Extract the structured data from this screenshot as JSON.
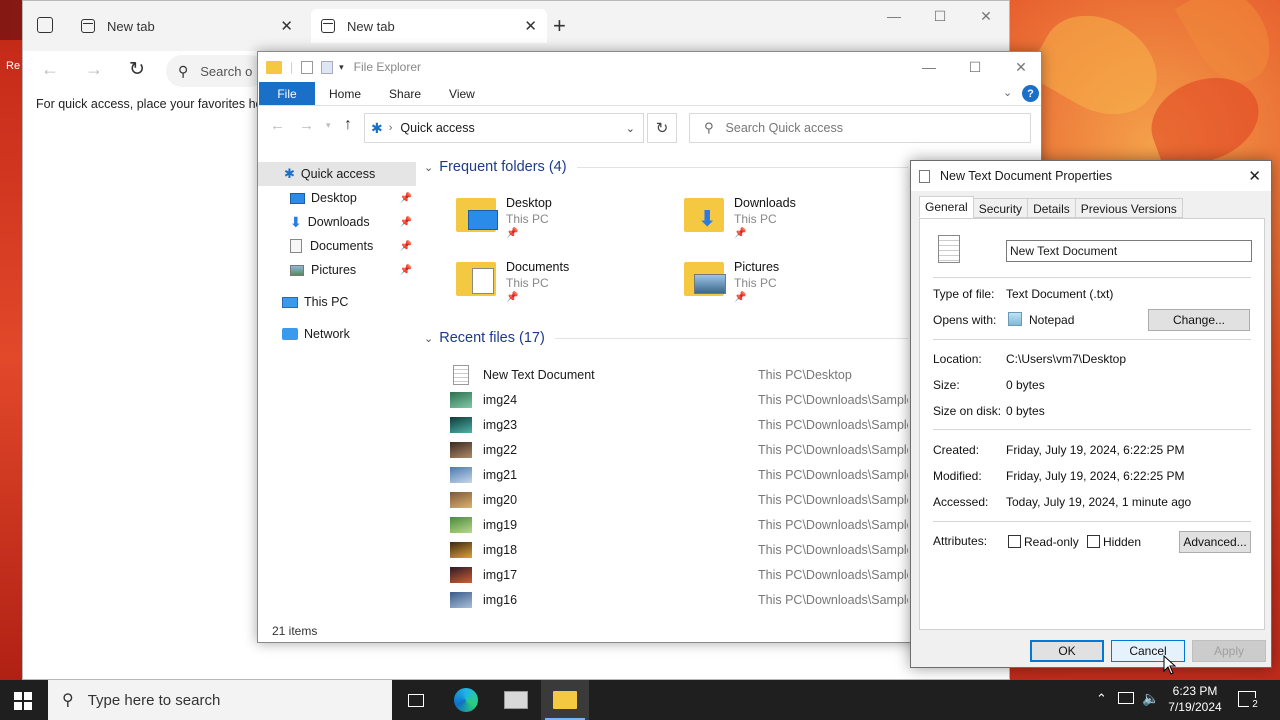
{
  "browser": {
    "tabs": [
      {
        "label": "New tab",
        "active": false
      },
      {
        "label": "New tab",
        "active": true
      }
    ],
    "search_placeholder": "Search o",
    "fav_hint": "For quick access, place your favorites her"
  },
  "desktop": {
    "icon_label": "Re"
  },
  "explorer": {
    "title": "File Explorer",
    "ribbon_tabs": [
      "File",
      "Home",
      "Share",
      "View"
    ],
    "address": "Quick access",
    "search_placeholder": "Search Quick access",
    "nav": [
      {
        "label": "Quick access",
        "icon": "star-icon",
        "pinned": false,
        "selected": true
      },
      {
        "label": "Desktop",
        "icon": "desktop-icon",
        "pinned": true
      },
      {
        "label": "Downloads",
        "icon": "download-icon",
        "pinned": true
      },
      {
        "label": "Documents",
        "icon": "document-icon",
        "pinned": true
      },
      {
        "label": "Pictures",
        "icon": "pictures-icon",
        "pinned": true
      },
      {
        "label": "This PC",
        "icon": "pc-icon",
        "pinned": false
      },
      {
        "label": "Network",
        "icon": "network-icon",
        "pinned": false
      }
    ],
    "frequent_header": "Frequent folders (4)",
    "frequent": [
      {
        "name": "Desktop",
        "location": "This PC"
      },
      {
        "name": "Downloads",
        "location": "This PC"
      },
      {
        "name": "Documents",
        "location": "This PC"
      },
      {
        "name": "Pictures",
        "location": "This PC"
      }
    ],
    "recent_header": "Recent files (17)",
    "recent": [
      {
        "name": "New Text Document",
        "path": "This PC\\Desktop",
        "kind": "text"
      },
      {
        "name": "img24",
        "path": "This PC\\Downloads\\Sample I",
        "kind": "image",
        "colors": [
          "#2f6f4f",
          "#7fc9a8"
        ]
      },
      {
        "name": "img23",
        "path": "This PC\\Downloads\\Sample I",
        "kind": "image",
        "colors": [
          "#0e3a3a",
          "#4fb3a8"
        ]
      },
      {
        "name": "img22",
        "path": "This PC\\Downloads\\Sample I",
        "kind": "image",
        "colors": [
          "#3a2a20",
          "#b08a6a"
        ]
      },
      {
        "name": "img21",
        "path": "This PC\\Downloads\\Sample I",
        "kind": "image",
        "colors": [
          "#4a78b0",
          "#c7d8e8"
        ]
      },
      {
        "name": "img20",
        "path": "This PC\\Downloads\\Sample I",
        "kind": "image",
        "colors": [
          "#7a5a3a",
          "#e0b070"
        ]
      },
      {
        "name": "img19",
        "path": "This PC\\Downloads\\Sample I",
        "kind": "image",
        "colors": [
          "#4a8a3a",
          "#b8d890"
        ]
      },
      {
        "name": "img18",
        "path": "This PC\\Downloads\\Sample I",
        "kind": "image",
        "colors": [
          "#3a2a10",
          "#e0a040"
        ]
      },
      {
        "name": "img17",
        "path": "This PC\\Downloads\\Sample I",
        "kind": "image",
        "colors": [
          "#2a1a2a",
          "#d06030"
        ]
      },
      {
        "name": "img16",
        "path": "This PC\\Downloads\\Sample I",
        "kind": "image",
        "colors": [
          "#3a5a8a",
          "#a8c0d8"
        ]
      }
    ],
    "status": "21 items"
  },
  "props": {
    "title": "New Text Document Properties",
    "tabs": [
      "General",
      "Security",
      "Details",
      "Previous Versions"
    ],
    "filename": "New Text Document",
    "type_label": "Type of file:",
    "type_value": "Text Document (.txt)",
    "opens_label": "Opens with:",
    "opens_value": "Notepad",
    "change_button": "Change...",
    "location_label": "Location:",
    "location_value": "C:\\Users\\vm7\\Desktop",
    "size_label": "Size:",
    "size_value": "0 bytes",
    "sizedisk_label": "Size on disk:",
    "sizedisk_value": "0 bytes",
    "created_label": "Created:",
    "created_value": "Friday, July 19, 2024, 6:22:25 PM",
    "modified_label": "Modified:",
    "modified_value": "Friday, July 19, 2024, 6:22:25 PM",
    "accessed_label": "Accessed:",
    "accessed_value": "Today, July 19, 2024, 1 minute ago",
    "attributes_label": "Attributes:",
    "readonly_label": "Read-only",
    "hidden_label": "Hidden",
    "advanced_button": "Advanced...",
    "ok_button": "OK",
    "cancel_button": "Cancel",
    "apply_button": "Apply"
  },
  "taskbar": {
    "search_placeholder": "Type here to search",
    "time": "6:23 PM",
    "date": "7/19/2024",
    "notification_count": "2"
  },
  "colors": {
    "accent": "#1a6fc7",
    "folder": "#f5c842"
  }
}
